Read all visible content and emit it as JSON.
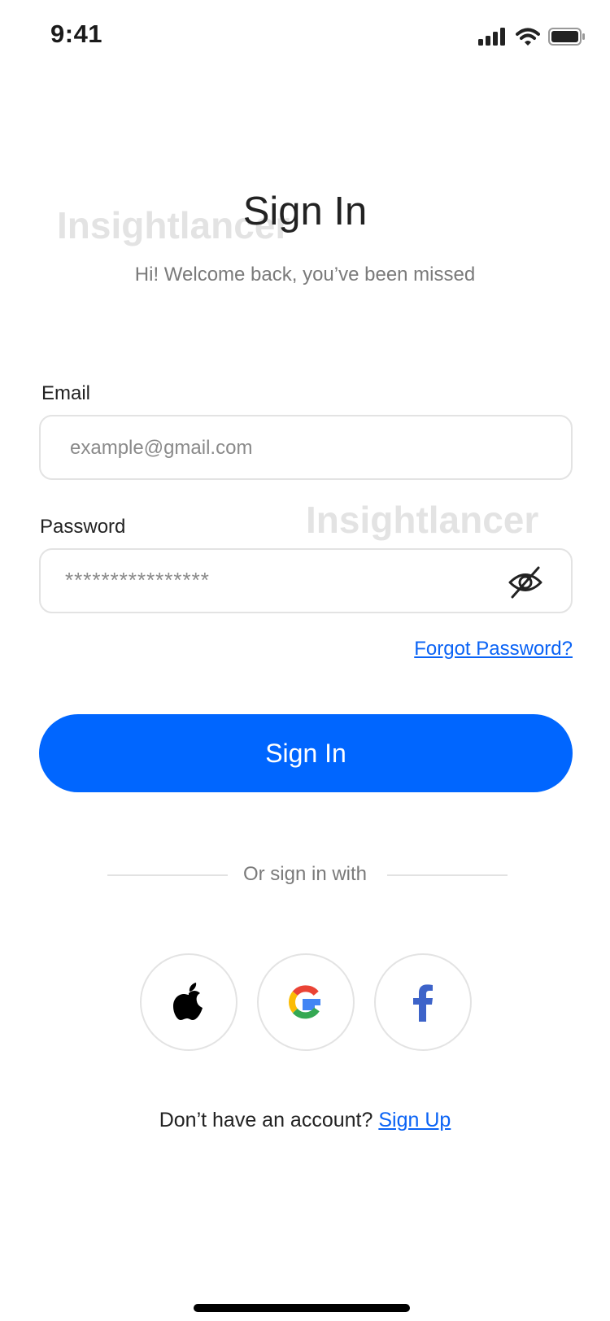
{
  "status_bar": {
    "time": "9:41",
    "icons": [
      "signal-icon",
      "wifi-icon",
      "battery-icon"
    ]
  },
  "watermark": "Insightlancer",
  "header": {
    "title": "Sign In",
    "subtitle": "Hi! Welcome back, you’ve been missed"
  },
  "form": {
    "email_label": "Email",
    "email_placeholder": "example@gmail.com",
    "password_label": "Password",
    "password_value": "****************",
    "forgot_label": "Forgot Password?",
    "submit_label": "Sign In"
  },
  "social": {
    "divider_label": "Or sign in with",
    "providers": [
      "apple-icon",
      "google-icon",
      "facebook-icon"
    ]
  },
  "footer": {
    "prompt": "Don’t have an account?",
    "signup_label": "Sign Up"
  },
  "colors": {
    "primary": "#0066ff",
    "link": "#0a63f5",
    "border": "#e3e3e3",
    "muted_text": "#7a7a7a"
  }
}
